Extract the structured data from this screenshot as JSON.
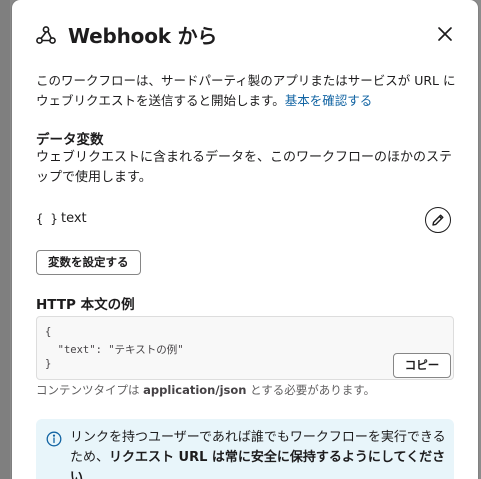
{
  "modal": {
    "title": "Webhook から",
    "description_text": "このワークフローは、サードパーティ製のアプリまたはサービスが URL にウェブリクエストを送信すると開始します。",
    "description_link": "基本を確認する"
  },
  "data_variables": {
    "heading": "データ変数",
    "description": "ウェブリクエストに含まれるデータを、このワークフローのほかのステップで使用します。",
    "variable": {
      "type_symbol": "{ }",
      "name": "text"
    },
    "set_button_label": "変数を設定する"
  },
  "http_example": {
    "heading": "HTTP 本文の例",
    "code_lines": [
      "{",
      "  \"text\": \"テキストの例\"",
      "}"
    ],
    "copy_button_label": "コピー",
    "hint_prefix": "コンテンツタイプは ",
    "hint_strong": "application/json",
    "hint_suffix": " とする必要があります。"
  },
  "banner": {
    "text_before": "リンクを持つユーザーであれば誰でもワークフローを実行できるため、",
    "text_strong": "リクエスト URL は常に安全に保持するようにしてください"
  },
  "colors": {
    "link": "#1264a3",
    "banner_bg": "#e8f5fa",
    "info_icon": "#1264a3"
  },
  "icons": [
    "webhook-icon",
    "close-icon",
    "pencil-icon",
    "info-icon"
  ]
}
